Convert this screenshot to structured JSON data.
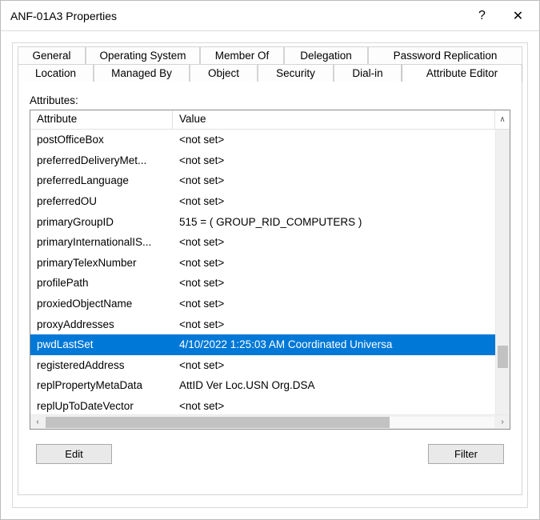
{
  "title": "ANF-01A3 Properties",
  "titlebar": {
    "help_label": "?",
    "close_label": "✕"
  },
  "tabs_row1": [
    {
      "label": "General"
    },
    {
      "label": "Operating System"
    },
    {
      "label": "Member Of"
    },
    {
      "label": "Delegation"
    },
    {
      "label": "Password Replication"
    }
  ],
  "tabs_row2": [
    {
      "label": "Location"
    },
    {
      "label": "Managed By"
    },
    {
      "label": "Object"
    },
    {
      "label": "Security"
    },
    {
      "label": "Dial-in"
    },
    {
      "label": "Attribute Editor"
    }
  ],
  "active_tab": "Attribute Editor",
  "attr_label": "Attributes:",
  "columns": {
    "attr": "Attribute",
    "value": "Value"
  },
  "rows": [
    {
      "attr": "postOfficeBox",
      "value": "<not set>"
    },
    {
      "attr": "preferredDeliveryMet...",
      "value": "<not set>"
    },
    {
      "attr": "preferredLanguage",
      "value": "<not set>"
    },
    {
      "attr": "preferredOU",
      "value": "<not set>"
    },
    {
      "attr": "primaryGroupID",
      "value": "515 = ( GROUP_RID_COMPUTERS )"
    },
    {
      "attr": "primaryInternationalIS...",
      "value": "<not set>"
    },
    {
      "attr": "primaryTelexNumber",
      "value": "<not set>"
    },
    {
      "attr": "profilePath",
      "value": "<not set>"
    },
    {
      "attr": "proxiedObjectName",
      "value": "<not set>"
    },
    {
      "attr": "proxyAddresses",
      "value": "<not set>"
    },
    {
      "attr": "pwdLastSet",
      "value": "4/10/2022 1:25:03 AM Coordinated Universa",
      "selected": true
    },
    {
      "attr": "registeredAddress",
      "value": "<not set>"
    },
    {
      "attr": "replPropertyMetaData",
      "value": " AttID  Ver     Loc.USN                 Org.DSA"
    },
    {
      "attr": "replUpToDateVector",
      "value": "<not set>"
    }
  ],
  "buttons": {
    "edit": "Edit",
    "filter": "Filter"
  }
}
